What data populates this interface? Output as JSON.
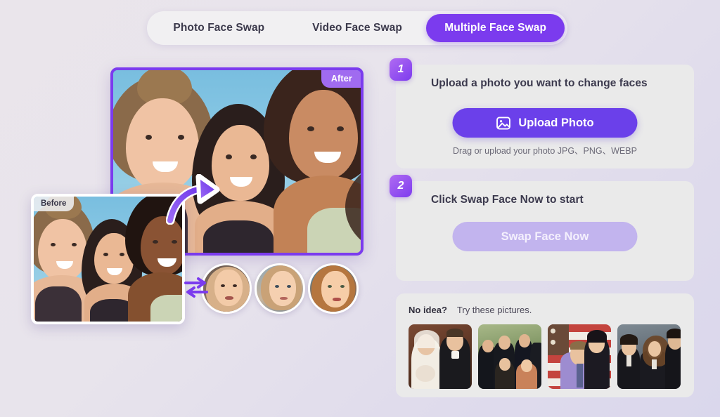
{
  "tabs": [
    {
      "label": "Photo Face Swap",
      "active": false
    },
    {
      "label": "Video Face Swap",
      "active": false
    },
    {
      "label": "Multiple Face Swap",
      "active": true
    }
  ],
  "preview": {
    "after_badge": "After",
    "before_badge": "Before",
    "swap_icon": "swap-horizontal-icon",
    "arrow_icon": "curved-arrow-icon",
    "face_thumbnails": [
      {
        "name": "face-option-1"
      },
      {
        "name": "face-option-2"
      },
      {
        "name": "face-option-3"
      }
    ]
  },
  "steps": [
    {
      "number": "1",
      "title": "Upload a photo you want to change faces",
      "button_label": "Upload Photo",
      "button_icon": "image-icon",
      "hint": "Drag or upload your photo JPG、PNG、WEBP"
    },
    {
      "number": "2",
      "title": "Click Swap Face Now to start",
      "button_label": "Swap Face Now",
      "button_disabled": true
    }
  ],
  "suggestions": {
    "heading": "No idea?",
    "subheading": "Try these pictures.",
    "items": [
      {
        "name": "sample-wedding-couple"
      },
      {
        "name": "sample-friends-group"
      },
      {
        "name": "sample-flag-couple"
      },
      {
        "name": "sample-school-trio"
      }
    ]
  },
  "colors": {
    "accent": "#7B3BEE",
    "accent_button": "#6B40EA",
    "accent_disabled": "#C2B4EE",
    "badge_after": "#A06BF0",
    "card_bg": "#EAEAEA",
    "tabbar_bg": "#F1F0F2",
    "page_bg": "#E8E4EC"
  }
}
